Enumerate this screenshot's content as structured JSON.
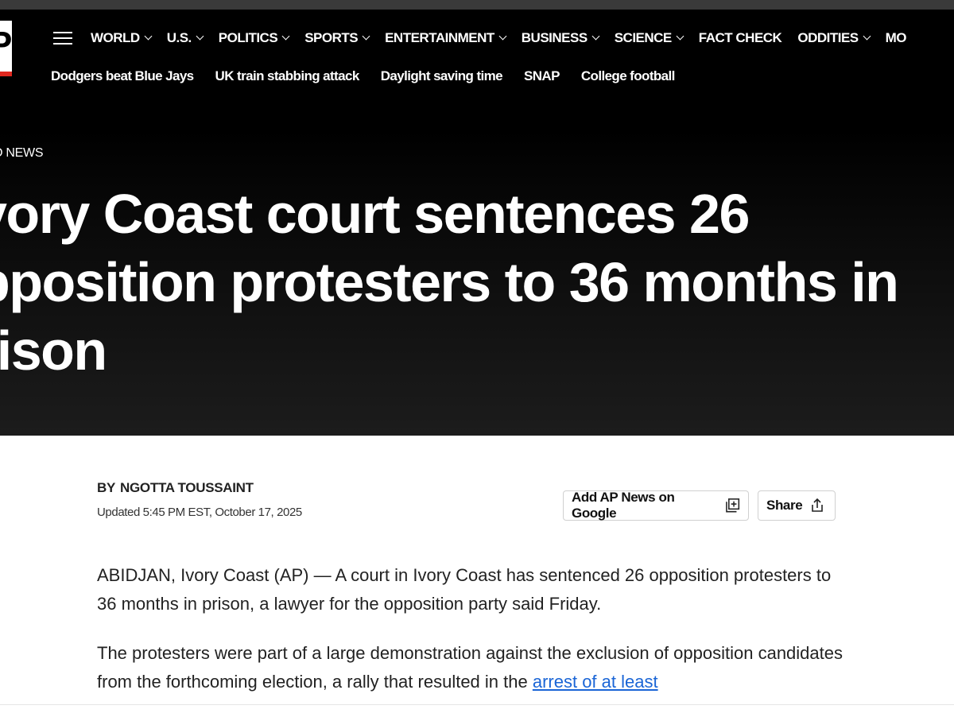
{
  "nav": {
    "items": [
      {
        "label": "WORLD",
        "dropdown": true
      },
      {
        "label": "U.S.",
        "dropdown": true
      },
      {
        "label": "POLITICS",
        "dropdown": true
      },
      {
        "label": "SPORTS",
        "dropdown": true
      },
      {
        "label": "ENTERTAINMENT",
        "dropdown": true
      },
      {
        "label": "BUSINESS",
        "dropdown": true
      },
      {
        "label": "SCIENCE",
        "dropdown": true
      },
      {
        "label": "FACT CHECK",
        "dropdown": false
      },
      {
        "label": "ODDITIES",
        "dropdown": true
      },
      {
        "label": "MO",
        "dropdown": false
      }
    ]
  },
  "trending": [
    "Dodgers beat Blue Jays",
    "UK train stabbing attack",
    "Daylight saving time",
    "SNAP",
    "College football"
  ],
  "article": {
    "section": "D NEWS",
    "headline": "vory Coast court sentences 26 pposition protesters to 36 months in rison",
    "byline_prefix": "BY",
    "author": "NGOTTA TOUSSAINT",
    "updated": "Updated 5:45 PM EST, October 17, 2025",
    "paragraph1": "ABIDJAN, Ivory Coast (AP) — A court in Ivory Coast has sentenced 26 opposition protesters to 36 months in prison, a lawyer for the opposition party said Friday.",
    "paragraph2_text": "The protesters were part of a large demonstration against the exclusion of opposition candidates from the forthcoming election, a rally that resulted in the ",
    "paragraph2_link": "arrest of at least"
  },
  "actions": {
    "google_label": "Add AP News on Google",
    "share_label": "Share"
  },
  "colors": {
    "header_bg": "#000000",
    "link": "#1a65d6",
    "logo_red": "#e0281f"
  },
  "icons": [
    "menu-icon",
    "chevron-down-icon",
    "add-source-icon",
    "share-icon"
  ]
}
